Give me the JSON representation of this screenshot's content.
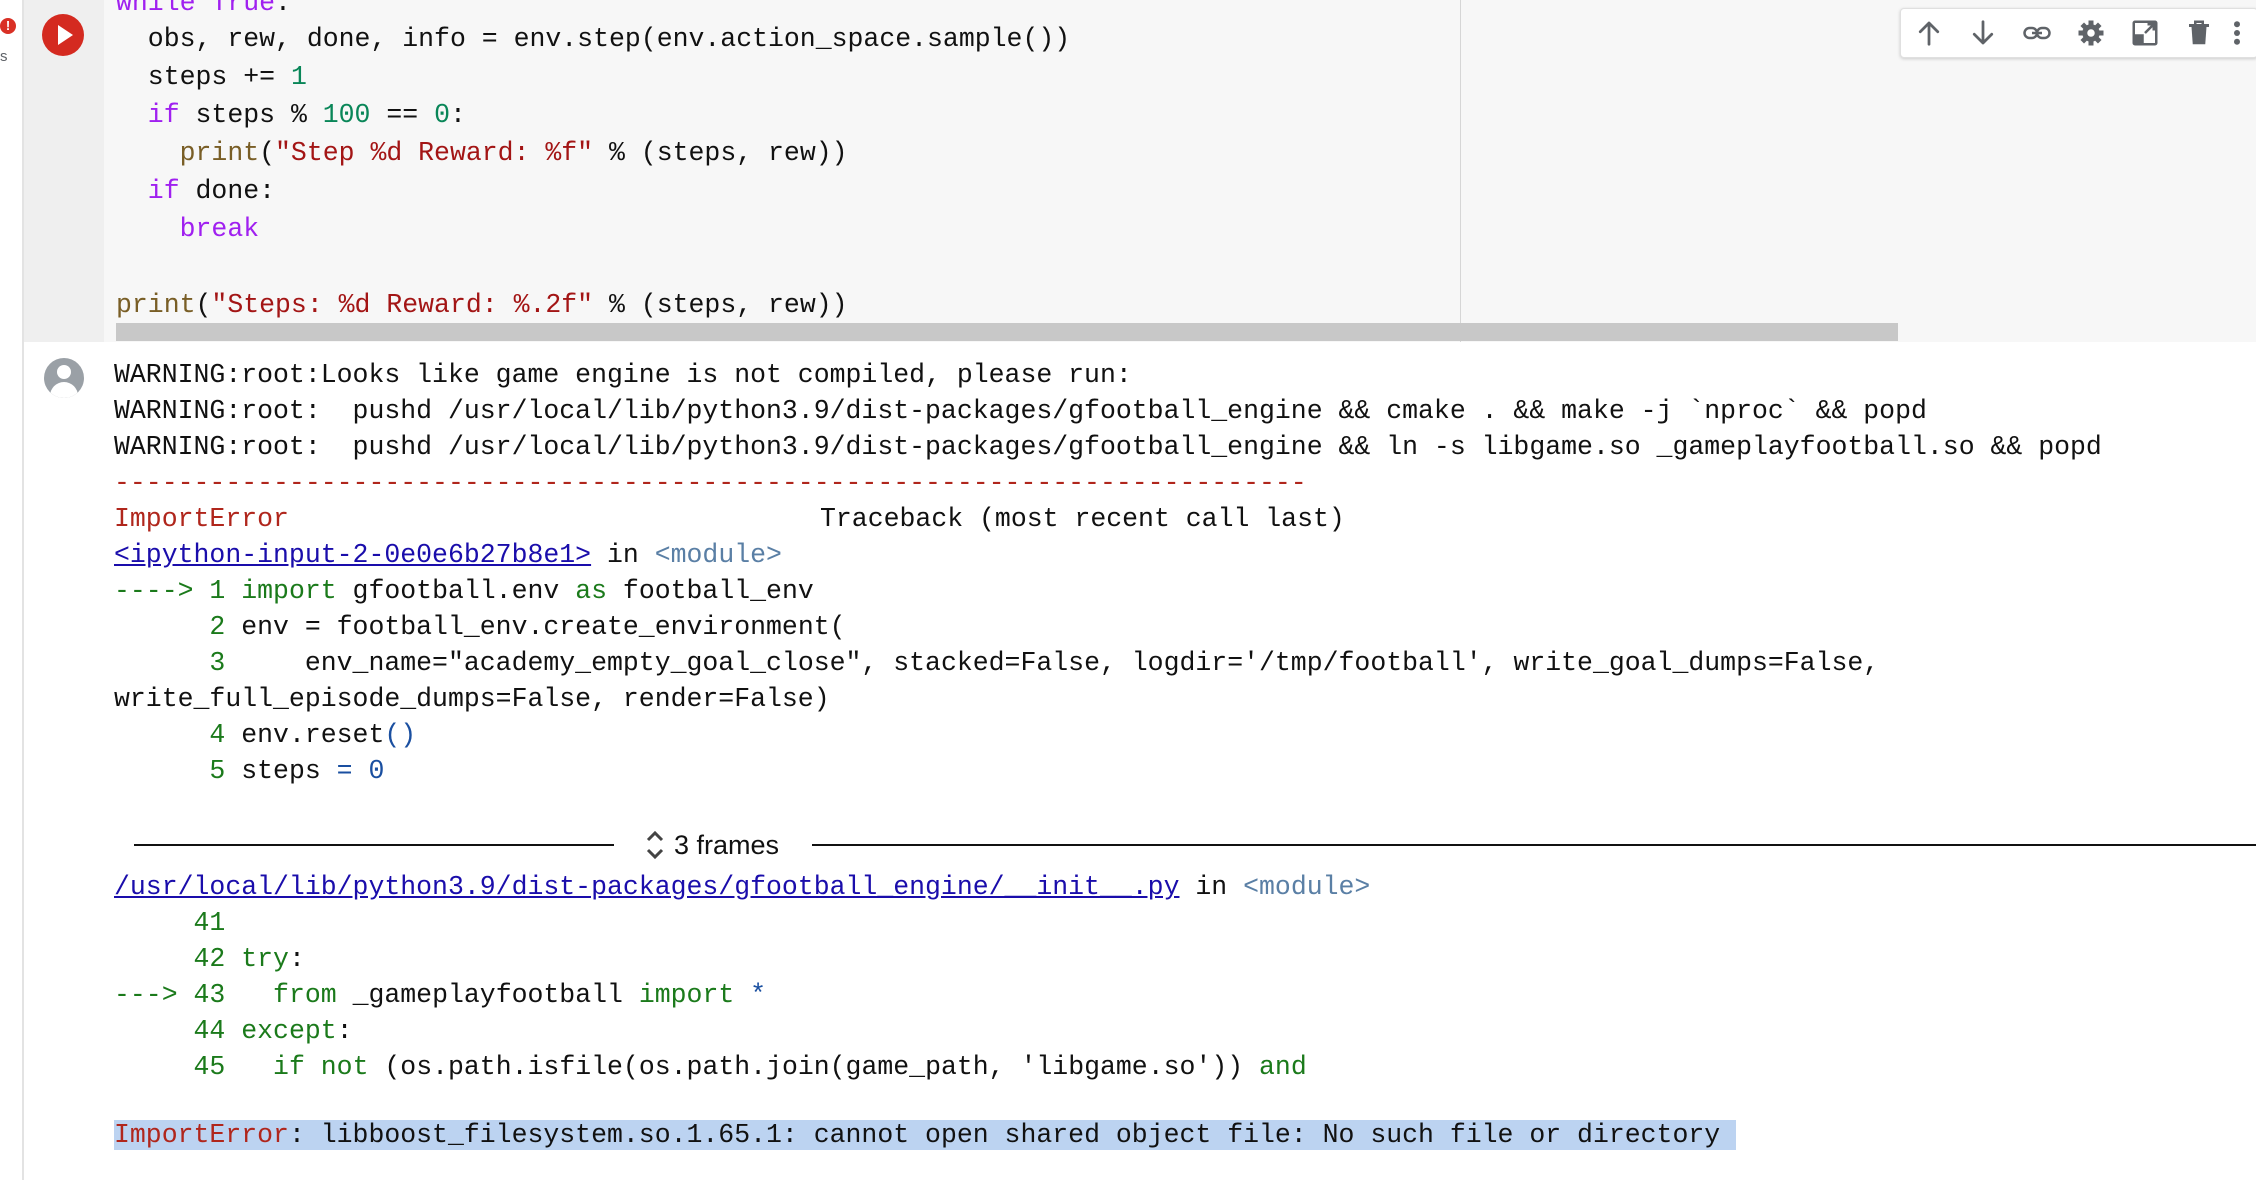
{
  "status": {
    "error_badge": "!",
    "error_sub": "s"
  },
  "code": {
    "lines": [
      {
        "segments": [
          [
            "kw",
            "while "
          ],
          [
            "kw",
            "True"
          ],
          [
            "",
            "."
          ]
        ]
      },
      {
        "segments": [
          [
            "",
            "  obs, rew, done, info = env.step(env.action_space.sample())"
          ]
        ]
      },
      {
        "segments": [
          [
            "",
            "  steps += "
          ],
          [
            "num",
            "1"
          ]
        ]
      },
      {
        "segments": [
          [
            "kw",
            "  if"
          ],
          [
            "",
            " steps % "
          ],
          [
            "num",
            "100"
          ],
          [
            "",
            " == "
          ],
          [
            "num",
            "0"
          ],
          [
            "",
            ":"
          ]
        ]
      },
      {
        "segments": [
          [
            "fn",
            "    print"
          ],
          [
            "",
            "("
          ],
          [
            "str",
            "\"Step %d Reward: %f\""
          ],
          [
            "",
            " % (steps, rew))"
          ]
        ]
      },
      {
        "segments": [
          [
            "kw",
            "  if"
          ],
          [
            "",
            " done:"
          ]
        ]
      },
      {
        "segments": [
          [
            "kw",
            "    break"
          ]
        ]
      },
      {
        "segments": [
          [
            "",
            ""
          ]
        ]
      },
      {
        "segments": [
          [
            "fn",
            "print"
          ],
          [
            "",
            "("
          ],
          [
            "str",
            "\"Steps: %d Reward: %.2f\""
          ],
          [
            "",
            " % (steps, rew))"
          ]
        ]
      }
    ]
  },
  "toolbar": {
    "move_up": "Move cell up",
    "move_down": "Move cell down",
    "link": "Copy link to cell",
    "settings": "Open editor settings",
    "mirror": "Mirror cell in tab",
    "delete": "Delete cell",
    "more": "More cell actions"
  },
  "output": {
    "warnings": [
      "WARNING:root:Looks like game engine is not compiled, please run:",
      "WARNING:root:  pushd /usr/local/lib/python3.9/dist-packages/gfootball_engine && cmake . && make -j `nproc` && popd",
      "WARNING:root:  pushd /usr/local/lib/python3.9/dist-packages/gfootball_engine && ln -s libgame.so _gameplayfootball.so && popd"
    ],
    "dashes": "---------------------------------------------------------------------------",
    "error_name": "ImportError",
    "traceback_label": "Traceback (most recent call last)",
    "input_link": "<ipython-input-2-0e0e6b27b8e1>",
    "in_text": " in ",
    "module": "<module>",
    "frame1": [
      {
        "arrow": "----> ",
        "num": "1",
        "code": " import gfootball.env as football_env"
      },
      {
        "arrow": "      ",
        "num": "2",
        "code": " env = football_env.create_environment("
      },
      {
        "arrow": "      ",
        "num": "3",
        "code": "     env_name=\"academy_empty_goal_close\", stacked=False, logdir='/tmp/football', write_goal_dumps=False,"
      },
      {
        "arrow": "",
        "num": "",
        "code": "write_full_episode_dumps=False, render=False)"
      },
      {
        "arrow": "      ",
        "num": "4",
        "code": " env.reset()"
      },
      {
        "arrow": "      ",
        "num": "5",
        "code": " steps = 0"
      }
    ],
    "frames_label": "3 frames",
    "file_link": "/usr/local/lib/python3.9/dist-packages/gfootball_engine/__init__.py",
    "frame2": [
      {
        "arrow": "     ",
        "num": "41",
        "code": ""
      },
      {
        "arrow": "     ",
        "num": "42",
        "code": " try:"
      },
      {
        "arrow": "---> ",
        "num": "43",
        "code": "   from _gameplayfootball import *"
      },
      {
        "arrow": "     ",
        "num": "44",
        "code": " except:"
      },
      {
        "arrow": "     ",
        "num": "45",
        "code": "   if not (os.path.isfile(os.path.join(game_path, 'libgame.so')) and"
      }
    ],
    "final_error_name": "ImportError",
    "final_error_msg": ": libboost_filesystem.so.1.65.1: cannot open shared object file: No such file or directory"
  },
  "colors": {
    "run_button": "#d42a20",
    "keyword": "#a020f0",
    "string": "#a31515",
    "number": "#098658",
    "error_red": "#b0261c",
    "trace_green": "#1b7a1b",
    "highlight": "#bcd3f1"
  }
}
